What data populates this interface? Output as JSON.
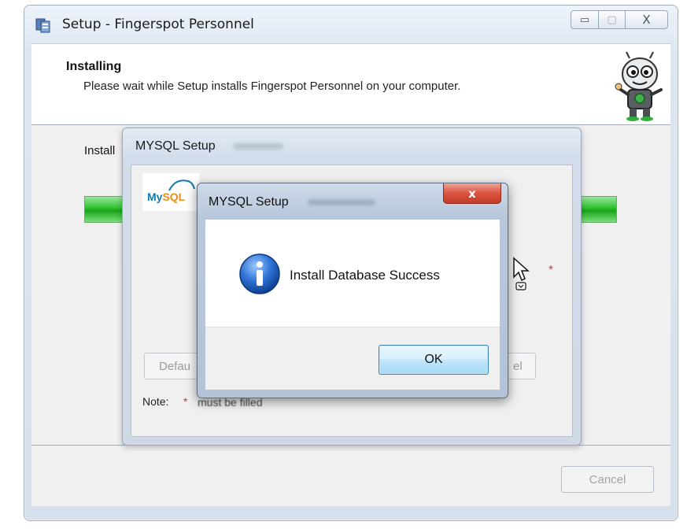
{
  "setup_window": {
    "title": "Setup - Fingerspot Personnel",
    "caption_buttons": {
      "minimize": "▭",
      "maximize": "▢",
      "close": "X"
    },
    "header": {
      "heading": "Installing",
      "subheading": "Please wait while Setup installs Fingerspot Personnel on your computer."
    },
    "install_label": "Install",
    "footer": {
      "cancel_label": "Cancel"
    }
  },
  "mysql_window": {
    "title": "MYSQL Setup",
    "logo_text_a": "My",
    "logo_text_b": "SQL",
    "default_button_label": "Defau",
    "cancel_button_label": "el",
    "note_label": "Note:",
    "note_star": "*",
    "note_text": "must be filled",
    "required_star": "*"
  },
  "message_box": {
    "title": "MYSQL Setup",
    "close_glyph": "x",
    "icon": "information-icon",
    "message": "Install Database Success",
    "ok_label": "OK"
  },
  "colors": {
    "progress_green": "#2fbf2f",
    "close_red": "#d9533f",
    "info_blue": "#1f5fc2",
    "ok_button": "#bee6fd"
  }
}
